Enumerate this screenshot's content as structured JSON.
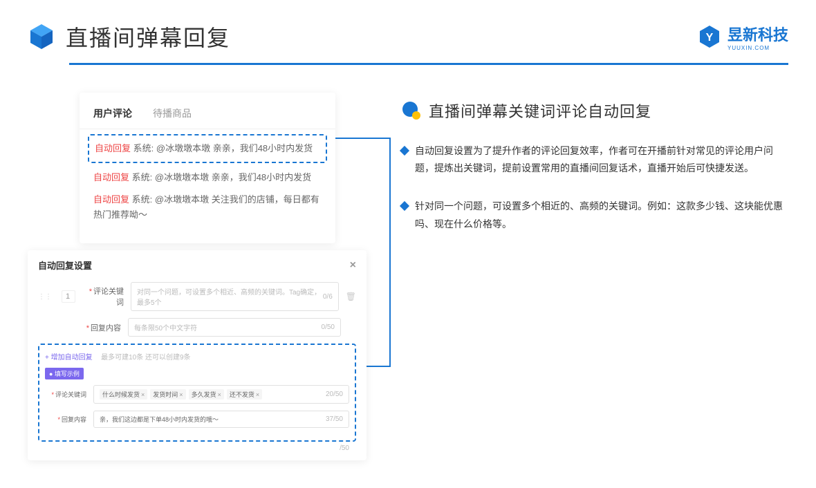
{
  "header": {
    "title": "直播间弹幕回复",
    "brand_name": "昱新科技",
    "brand_sub": "YUUXIN.COM"
  },
  "tabs": {
    "active": "用户评论",
    "inactive": "待播商品"
  },
  "comments": {
    "tag": "自动回复",
    "sys": "系统:",
    "c1": "@冰墩墩本墩 亲亲，我们48小时内发货",
    "c2": "@冰墩墩本墩 亲亲，我们48小时内发货",
    "c3": "@冰墩墩本墩 关注我们的店铺，每日都有热门推荐呦～"
  },
  "modal": {
    "title": "自动回复设置",
    "num": "1",
    "label_kw": "评论关键词",
    "label_content": "回复内容",
    "kw_placeholder": "对同一个问题，可设置多个相近、高频的关键词。Tag确定，最多5个",
    "kw_count": "0/6",
    "content_placeholder": "每条限50个中文字符",
    "content_count": "0/50",
    "add_link": "+ 增加自动回复",
    "add_hint": "最多可建10条 还可以创建9条",
    "badge": "● 填写示例",
    "ex_kw_count": "20/50",
    "ex_content": "亲，我们这边都是下单48小时内发货的哦～",
    "ex_content_count": "37/50",
    "tags": [
      "什么时候发货",
      "发货时间",
      "多久发货",
      "还不发货"
    ],
    "outer_count": "/50"
  },
  "right": {
    "section_title": "直播间弹幕关键词评论自动回复",
    "b1": "自动回复设置为了提升作者的评论回复效率，作者可在开播前针对常见的评论用户问题，提炼出关键词，提前设置常用的直播间回复话术，直播开始后可快捷发送。",
    "b2": "针对同一个问题，可设置多个相近的、高频的关键词。例如：这款多少钱、这块能优惠吗、现在什么价格等。"
  }
}
